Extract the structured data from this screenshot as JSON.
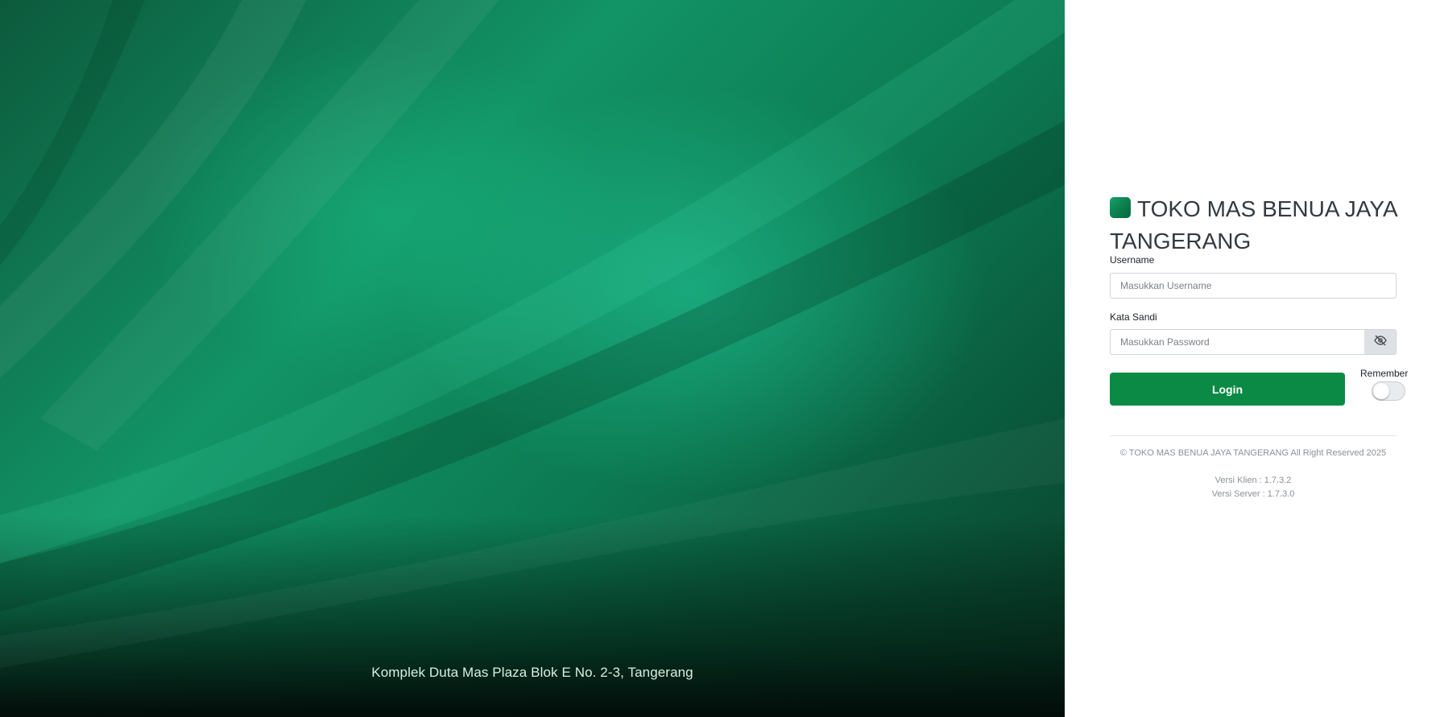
{
  "background": {
    "address": "Komplek Duta Mas Plaza Blok E No. 2-3, Tangerang"
  },
  "brand": {
    "logo_icon": "store-logo-icon",
    "title": "TOKO MAS BENUA JAYA TANGERANG"
  },
  "form": {
    "username_label": "Username",
    "username_placeholder": "Masukkan Username",
    "username_value": "",
    "password_label": "Kata Sandi",
    "password_placeholder": "Masukkan Password",
    "password_value": "",
    "show_password_icon": "eye-slash-icon",
    "login_label": "Login",
    "remember_label": "Remember",
    "remember_checked": false
  },
  "footer": {
    "copyright": "© TOKO MAS BENUA JAYA TANGERANG All Right Reserved 2025",
    "client_version": "Versi Klien : 1.7.3.2",
    "server_version": "Versi Server : 1.7.3.0"
  },
  "colors": {
    "primary": "#0b8a46",
    "background_green": "#0f7a52",
    "text": "#333a40"
  }
}
